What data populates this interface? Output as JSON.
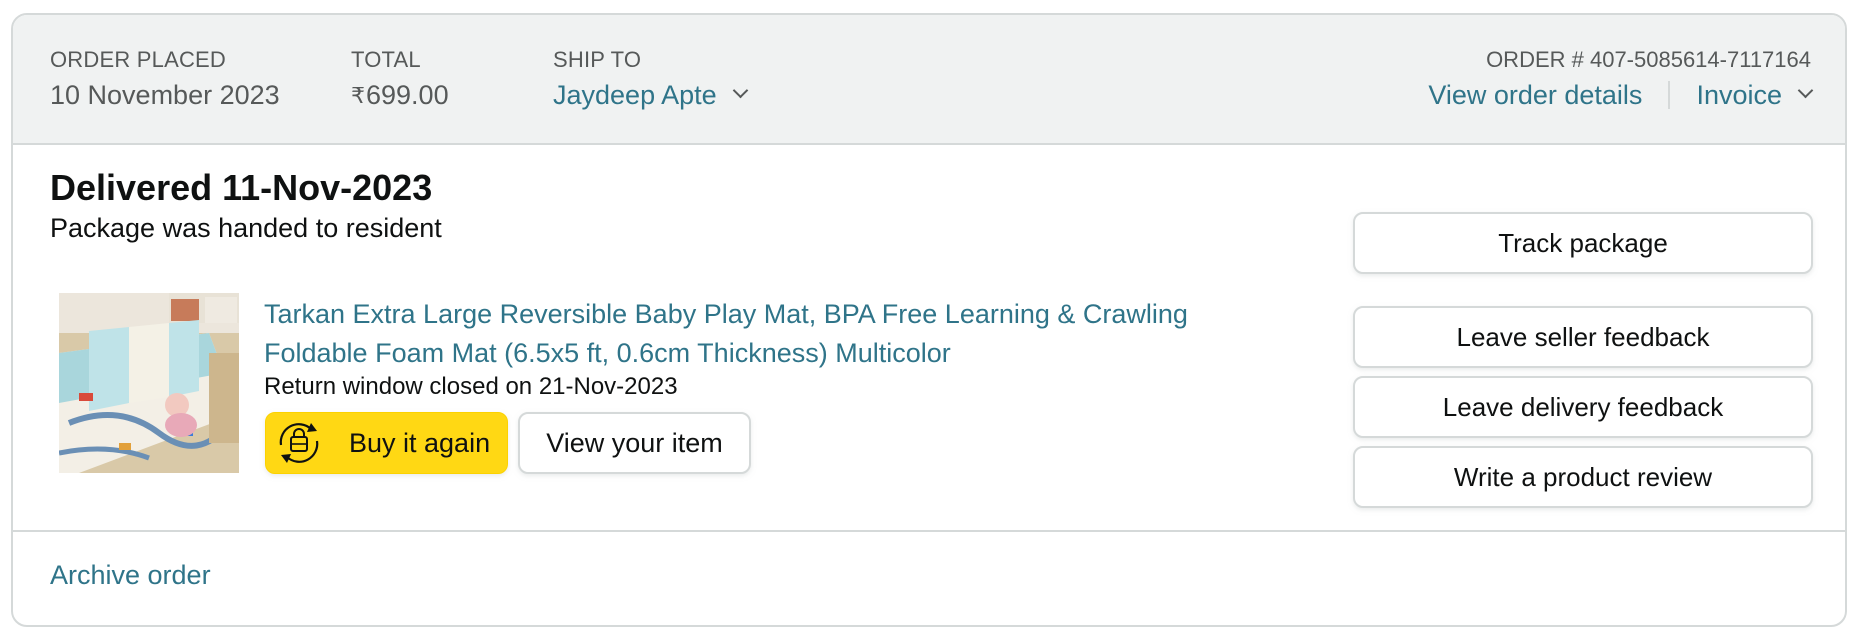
{
  "header": {
    "order_placed_label": "ORDER PLACED",
    "order_placed_value": "10 November 2023",
    "total_label": "TOTAL",
    "total_currency": "₹",
    "total_value": "699.00",
    "ship_to_label": "SHIP TO",
    "ship_to_name": "Jaydeep Apte",
    "order_number_text": "ORDER # 407-5085614-7117164",
    "view_order_details": "View order details",
    "invoice": "Invoice"
  },
  "shipment": {
    "status_title": "Delivered 11-Nov-2023",
    "status_sub": "Package was handed to resident"
  },
  "item": {
    "title": "Tarkan Extra Large Reversible Baby Play Mat, BPA Free Learning & Crawling Foldable Foam Mat (6.5x5 ft, 0.6cm Thickness) Multicolor",
    "return_window": "Return window closed on 21-Nov-2023",
    "buy_again_label": "Buy it again",
    "view_item_label": "View your item",
    "image_icon": "product-thumbnail"
  },
  "actions": {
    "track_package": "Track package",
    "leave_seller_feedback": "Leave seller feedback",
    "leave_delivery_feedback": "Leave delivery feedback",
    "write_product_review": "Write a product review"
  },
  "footer": {
    "archive_order": "Archive order"
  },
  "colors": {
    "header_bg": "#f0f2f2",
    "border": "#d5d9d9",
    "link": "#2f7489",
    "buy_button": "#ffd814",
    "text": "#0f1111",
    "muted": "#565959"
  }
}
